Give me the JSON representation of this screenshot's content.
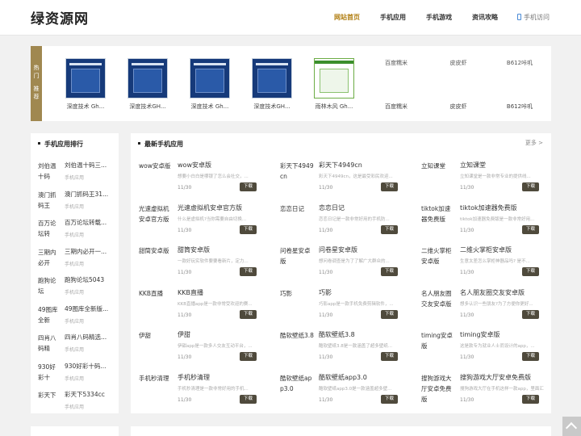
{
  "header": {
    "logo_text": "绿资源网",
    "nav": [
      "网站首页",
      "手机应用",
      "手机游戏",
      "资讯攻略"
    ],
    "mobile_label": "手机访问"
  },
  "featured": {
    "label": [
      "热",
      "门",
      "推",
      "荐"
    ],
    "items": [
      {
        "name": "深度技术 Gh...",
        "thumb": "blue-installer"
      },
      {
        "name": "深度技术GH...",
        "thumb": "blue-installer"
      },
      {
        "name": "深度技术 Gh...",
        "thumb": "blue-installer"
      },
      {
        "name": "深度技术GH...",
        "thumb": "blue-installer"
      },
      {
        "name": "雨林木风 Gh...",
        "thumb": "green-installer"
      },
      {
        "name": "百度糯米",
        "alt": "百度糯米"
      },
      {
        "name": "皮皮虾",
        "alt": "皮皮虾"
      },
      {
        "name": "B612咔叽",
        "alt": "B612咔叽"
      }
    ]
  },
  "ranking": {
    "title": "手机应用排行",
    "items": [
      {
        "icon_alt": "刘伯温十码",
        "name": "刘伯温十码三...",
        "cat": "手机应用"
      },
      {
        "icon_alt": "澳门抓码王",
        "name": "澳门抓码王31...",
        "cat": "手机应用"
      },
      {
        "icon_alt": "百万论坛转",
        "name": "百万论坛转载...",
        "cat": "手机应用"
      },
      {
        "icon_alt": "三期内必开",
        "name": "三期内必开一...",
        "cat": "手机应用"
      },
      {
        "icon_alt": "跑狗论坛",
        "name": "跑狗论坛5043",
        "cat": "手机应用"
      },
      {
        "icon_alt": "49图库全新",
        "name": "49图库全新版...",
        "cat": "手机应用"
      },
      {
        "icon_alt": "四肖八码精",
        "name": "四肖八码精选...",
        "cat": "手机应用"
      },
      {
        "icon_alt": "930好彩十",
        "name": "930好彩十码...",
        "cat": "手机应用"
      },
      {
        "icon_alt": "彩天下",
        "name": "彩天下5334cc",
        "cat": "手机应用"
      }
    ]
  },
  "latest": {
    "title": "最新手机应用",
    "more": "更多 >",
    "download_label": "下载",
    "apps": [
      {
        "icon_alt": "wow安卓版",
        "name": "wow安卓版",
        "desc": "想要小白白是哪银了怎么会社交，...",
        "date": "11/30"
      },
      {
        "icon_alt": "彩天下4949cn",
        "name": "彩天下4949cn",
        "desc": "彩天下4949cn，这是最受彩民欢迎...",
        "date": "11/30"
      },
      {
        "icon_alt": "立知课堂",
        "name": "立知课堂",
        "desc": "立知课堂是一款非常专业的提供线...",
        "date": "11/30"
      },
      {
        "icon_alt": "光速虚拟机安卓官方版",
        "name": "光速虚拟机安卓官方版",
        "desc": "什么是虚拟机?当你需要自由切换...",
        "date": "11/30"
      },
      {
        "icon_alt": "恋恋日记",
        "name": "恋恋日记",
        "desc": "恋恋日记是一款非常好用的手机防...",
        "date": "11/30"
      },
      {
        "icon_alt": "tiktok加速器免费版",
        "name": "tiktok加速器免费版",
        "desc": "tiktok加速器免费版是一款非常好用...",
        "date": "11/30"
      },
      {
        "icon_alt": "甜筒安卓版",
        "name": "甜筒安卓版",
        "desc": "一款好玩实软件要要看新片，定力...",
        "date": "11/30"
      },
      {
        "icon_alt": "问卷星安卓版",
        "name": "问卷星安卓版",
        "desc": "想问卷调查是为了了解广大群众的...",
        "date": "11/30"
      },
      {
        "icon_alt": "二维火掌柜安卓版",
        "name": "二维火掌柜安卓版",
        "desc": "生意太差怎么掌柜神器品吗? 是不...",
        "date": "11/30"
      },
      {
        "icon_alt": "KKB直播",
        "name": "KKB直播",
        "desc": "KKB直播app是一款非常受欢迎的赛...",
        "date": "11/30"
      },
      {
        "icon_alt": "巧影",
        "name": "巧影",
        "desc": "巧影app是一款手机免费剪辑软件，...",
        "date": "11/30"
      },
      {
        "icon_alt": "名人朋友圈交友安卓版",
        "name": "名人朋友圈交友安卓版",
        "desc": "想多认识一些朋友?为了方便你更好...",
        "date": "11/30"
      },
      {
        "icon_alt": "伊甜",
        "name": "伊甜",
        "desc": "伊甜app是一款多人交友互动平台，...",
        "date": "11/30"
      },
      {
        "icon_alt": "酷软壁纸3.8",
        "name": "酷软壁纸3.8",
        "desc": "酷软壁纸3.8是一款涵盖了超多壁纸...",
        "date": "11/30"
      },
      {
        "icon_alt": "timing安卓版",
        "name": "timing安卓版",
        "desc": "这是款专为就业人士而设计的app，...",
        "date": "11/30"
      },
      {
        "icon_alt": "手机秒清理",
        "name": "手机秒清理",
        "desc": "手机秒清理是一款非常好用的手机...",
        "date": "11/30"
      },
      {
        "icon_alt": "酷软壁纸app3.0",
        "name": "酷软壁纸app3.0",
        "desc": "酷软壁纸app3.0是一款涵盖超多壁...",
        "date": "11/30"
      },
      {
        "icon_alt": "搜狗游戏大厅安卓免费版",
        "name": "搜狗游戏大厅安卓免费版",
        "desc": "搜狗游戏大厅在手机这样一款app，里面汇...",
        "date": "11/30"
      }
    ]
  }
}
